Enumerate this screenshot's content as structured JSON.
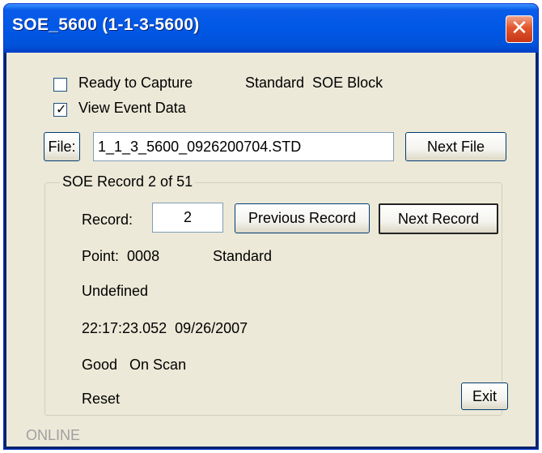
{
  "window": {
    "title": "SOE_5600 (1-1-3-5600)",
    "close_glyph": "✕"
  },
  "options": {
    "ready_to_capture": {
      "label": "Ready to Capture",
      "checked": false
    },
    "view_event_data": {
      "label": "View Event Data",
      "checked": true
    },
    "block_type_text": "Standard  SOE Block"
  },
  "file_row": {
    "file_button_label": "File:",
    "file_name": "1_1_3_5600_0926200704.STD",
    "next_file_label": "Next File"
  },
  "record_group": {
    "title": "SOE Record 2 of 51",
    "record_label": "Record:",
    "record_value": "2",
    "previous_record_label": "Previous Record",
    "next_record_label": "Next Record",
    "point_line": "Point:  0008",
    "point_type": "Standard",
    "description": "Undefined",
    "timestamp": "22:17:23.052  09/26/2007",
    "quality": "Good   On Scan",
    "state": "Reset",
    "exit_label": "Exit"
  },
  "status": {
    "text": "ONLINE"
  },
  "colors": {
    "titlebar": "#0058e6",
    "client_bg": "#ece9d8",
    "close_button": "#e2562b",
    "status_text": "#a0a0a0"
  }
}
